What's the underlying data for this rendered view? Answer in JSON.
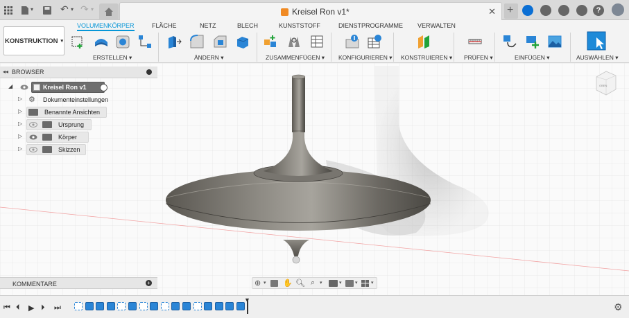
{
  "window": {
    "document_title": "Kreisel Ron v1*"
  },
  "ribbon": {
    "workspace_label": "KONSTRUKTION",
    "tabs": [
      {
        "label": "VOLUMENKÖRPER",
        "active": true
      },
      {
        "label": "FLÄCHE",
        "active": false
      },
      {
        "label": "NETZ",
        "active": false
      },
      {
        "label": "BLECH",
        "active": false
      },
      {
        "label": "KUNSTSTOFF",
        "active": false
      },
      {
        "label": "DIENSTPROGRAMME",
        "active": false
      },
      {
        "label": "VERWALTEN",
        "active": false
      }
    ],
    "groups": [
      {
        "label": "ERSTELLEN"
      },
      {
        "label": "ÄNDERN"
      },
      {
        "label": "ZUSAMMENFÜGEN"
      },
      {
        "label": "KONFIGURIEREN"
      },
      {
        "label": "KONSTRUIEREN"
      },
      {
        "label": "PRÜFEN"
      },
      {
        "label": "EINFÜGEN"
      },
      {
        "label": "AUSWÄHLEN"
      }
    ]
  },
  "browser": {
    "header": "BROWSER",
    "root": {
      "label": "Kreisel Ron v1"
    },
    "items": [
      {
        "label": "Dokumenteinstellungen",
        "icon": "gear-icon"
      },
      {
        "label": "Benannte Ansichten",
        "icon": "folder-icon"
      },
      {
        "label": "Ursprung",
        "icon": "folder-icon"
      },
      {
        "label": "Körper",
        "icon": "folder-icon"
      },
      {
        "label": "Skizzen",
        "icon": "folder-icon"
      }
    ]
  },
  "comments": {
    "header": "KOMMENTARE"
  },
  "viewcube": {
    "face_label": "OBEN"
  },
  "colors": {
    "accent": "#0696d7",
    "brand_orange": "#f08a24",
    "body_metal": "#6e6b66"
  }
}
